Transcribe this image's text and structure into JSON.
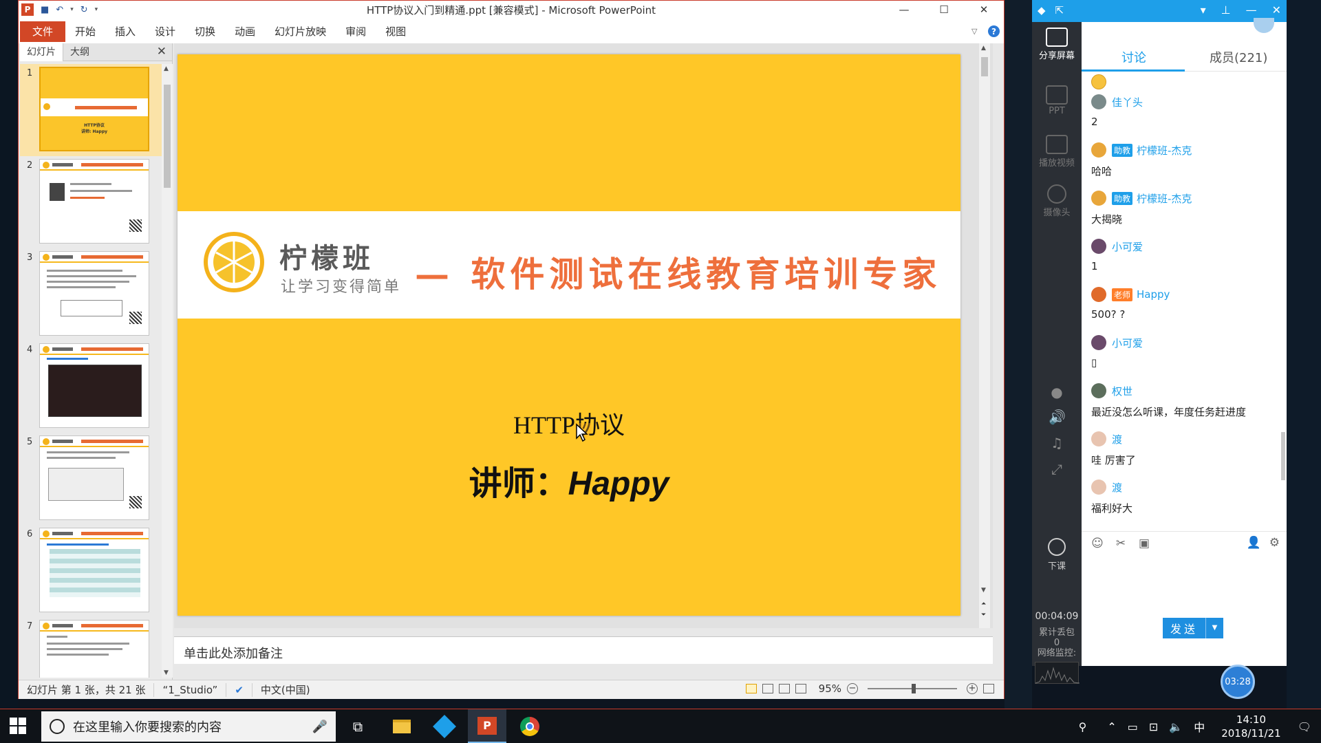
{
  "ppt": {
    "title": "HTTP协议入门到精通.ppt [兼容模式] - Microsoft PowerPoint",
    "logo": "P",
    "ribbon_tabs": [
      "文件",
      "开始",
      "插入",
      "设计",
      "切换",
      "动画",
      "幻灯片放映",
      "审阅",
      "视图"
    ],
    "pane_tabs": [
      "幻灯片",
      "大纲"
    ],
    "thumbnails": [
      "1",
      "2",
      "3",
      "4",
      "5",
      "6",
      "7"
    ],
    "slide": {
      "brand_name": "柠檬班",
      "brand_slogan": "让学习变得简单",
      "brand_tagline": "— 软件测试在线教育培训专家",
      "subtitle": "HTTP协议",
      "presenter_prefix": "讲师：",
      "presenter_name": "Happy",
      "bg_color": "#ffc727",
      "tagline_color": "#ee6f3c"
    },
    "notes_placeholder": "单击此处添加备注",
    "status": {
      "slide_info": "幻灯片 第 1 张，共 21 张",
      "theme": "“1_Studio”",
      "language": "中文(中国)",
      "zoom": "95%"
    }
  },
  "chat": {
    "tabs": {
      "discuss": "讨论",
      "members": "成员(221)"
    },
    "side_buttons": {
      "share": "分享屏幕",
      "ppt": "PPT",
      "video": "播放视频",
      "camera": "摄像头"
    },
    "end_class": "下课",
    "timer": "00:04:09",
    "packet_label": "累计丢包",
    "packet_value": "0",
    "net_label": "网络监控:",
    "messages": [
      {
        "name": "佳丫头",
        "role": "",
        "text": "2"
      },
      {
        "name": "柠檬班-杰克",
        "role": "助教",
        "text": "哈哈"
      },
      {
        "name": "柠檬班-杰克",
        "role": "助教",
        "text": "大揭晓"
      },
      {
        "name": "小可爱",
        "role": "",
        "text": "1"
      },
      {
        "name": "Happy",
        "role": "老师",
        "text": "500? ?"
      },
      {
        "name": "小可爱",
        "role": "",
        "text": "▯"
      },
      {
        "name": "权世",
        "role": "",
        "text": "最近没怎么听课，年度任务赶进度"
      },
      {
        "name": "渡",
        "role": "",
        "text": "哇 厉害了"
      },
      {
        "name": "渡",
        "role": "",
        "text": "福利好大"
      }
    ],
    "send_label": "发送",
    "float_timer": "03:28",
    "accent_color": "#1e9fe9"
  },
  "taskbar": {
    "search_placeholder": "在这里输入你要搜索的内容",
    "time": "14:10",
    "date": "2018/11/21",
    "ime": "中"
  }
}
